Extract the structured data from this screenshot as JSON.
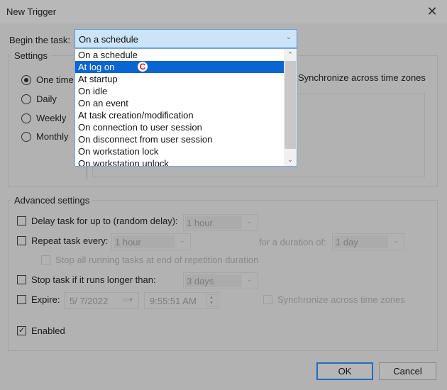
{
  "window": {
    "title": "New Trigger",
    "close_icon": "close-icon"
  },
  "begin_task": {
    "label": "Begin the task:",
    "selected": "On a schedule",
    "options": [
      "On a schedule",
      "At log on",
      "At startup",
      "On idle",
      "On an event",
      "At task creation/modification",
      "On connection to user session",
      "On disconnect from user session",
      "On workstation lock",
      "On workstation unlock"
    ],
    "highlighted_index": 1,
    "cursor_marker": "C"
  },
  "settings": {
    "title": "Settings",
    "radios": [
      {
        "label": "One time",
        "checked": true
      },
      {
        "label": "Daily",
        "checked": false
      },
      {
        "label": "Weekly",
        "checked": false
      },
      {
        "label": "Monthly",
        "checked": false
      }
    ],
    "sync_label": "Synchronize across time zones"
  },
  "advanced": {
    "title": "Advanced settings",
    "delay": {
      "label": "Delay task for up to (random delay):",
      "checked": false,
      "value": "1 hour"
    },
    "repeat": {
      "label": "Repeat task every:",
      "checked": false,
      "value": "1 hour",
      "duration_label": "for a duration of:",
      "duration_value": "1 day"
    },
    "stop_all": {
      "label": "Stop all running tasks at end of repetition duration",
      "checked": false
    },
    "stop_if_longer": {
      "label": "Stop task if it runs longer than:",
      "checked": false,
      "value": "3 days"
    },
    "expire": {
      "label": "Expire:",
      "checked": false,
      "date": "5/ 7/2022",
      "time": "9:55:51 AM",
      "sync_label": "Synchronize across time zones"
    },
    "enabled": {
      "label": "Enabled",
      "checked": true
    }
  },
  "buttons": {
    "ok": "OK",
    "cancel": "Cancel"
  },
  "colors": {
    "selection": "#0a64d2",
    "focus_border": "#1f6fc0",
    "combo_focus_bg": "#cce4f7"
  }
}
